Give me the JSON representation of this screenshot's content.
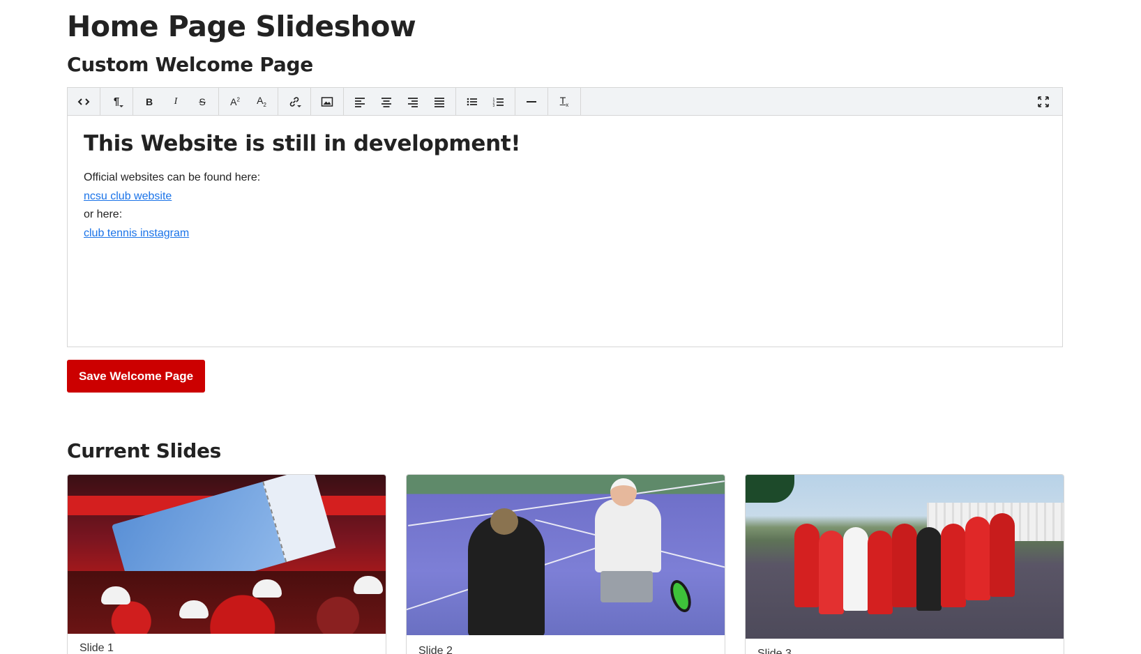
{
  "page": {
    "title": "Home Page Slideshow",
    "welcome_section_title": "Custom Welcome Page",
    "slides_section_title": "Current Slides"
  },
  "toolbar": {
    "buttons": [
      {
        "name": "code-view",
        "icon": "code-icon",
        "glyph": "<>"
      },
      {
        "name": "paragraph-format",
        "icon": "paragraph-icon",
        "glyph": "¶"
      },
      {
        "name": "bold",
        "icon": "bold-icon",
        "glyph": "B"
      },
      {
        "name": "italic",
        "icon": "italic-icon",
        "glyph": "I"
      },
      {
        "name": "strikethrough",
        "icon": "strikethrough-icon",
        "glyph": "S"
      },
      {
        "name": "superscript",
        "icon": "superscript-icon",
        "glyph": "A²"
      },
      {
        "name": "subscript",
        "icon": "subscript-icon",
        "glyph": "A₂"
      },
      {
        "name": "insert-link",
        "icon": "link-icon",
        "glyph": "🔗"
      },
      {
        "name": "insert-image",
        "icon": "image-icon",
        "glyph": "▣"
      },
      {
        "name": "align-left",
        "icon": "align-left-icon",
        "glyph": "≡"
      },
      {
        "name": "align-center",
        "icon": "align-center-icon",
        "glyph": "≡"
      },
      {
        "name": "align-right",
        "icon": "align-right-icon",
        "glyph": "≡"
      },
      {
        "name": "align-justify",
        "icon": "align-justify-icon",
        "glyph": "≡"
      },
      {
        "name": "bullet-list",
        "icon": "bullet-list-icon",
        "glyph": "•"
      },
      {
        "name": "numbered-list",
        "icon": "numbered-list-icon",
        "glyph": "1."
      },
      {
        "name": "horizontal-rule",
        "icon": "horizontal-rule-icon",
        "glyph": "—"
      },
      {
        "name": "clear-formatting",
        "icon": "clear-format-icon",
        "glyph": "Tx"
      },
      {
        "name": "fullscreen",
        "icon": "fullscreen-icon",
        "glyph": "⤢"
      }
    ]
  },
  "editor": {
    "heading": "This Website is still in development!",
    "line1": "Official websites can be found here:",
    "link1": "ncsu club website",
    "line2": "or here:",
    "link2": "club tennis instagram"
  },
  "save_button_label": "Save Welcome Page",
  "slides": [
    {
      "caption": "Slide 1"
    },
    {
      "caption": "Slide 2"
    },
    {
      "caption": "Slide 3"
    }
  ],
  "colors": {
    "primary": "#cc0000",
    "link": "#1a73e8",
    "toolbar_bg": "#f1f3f5"
  }
}
